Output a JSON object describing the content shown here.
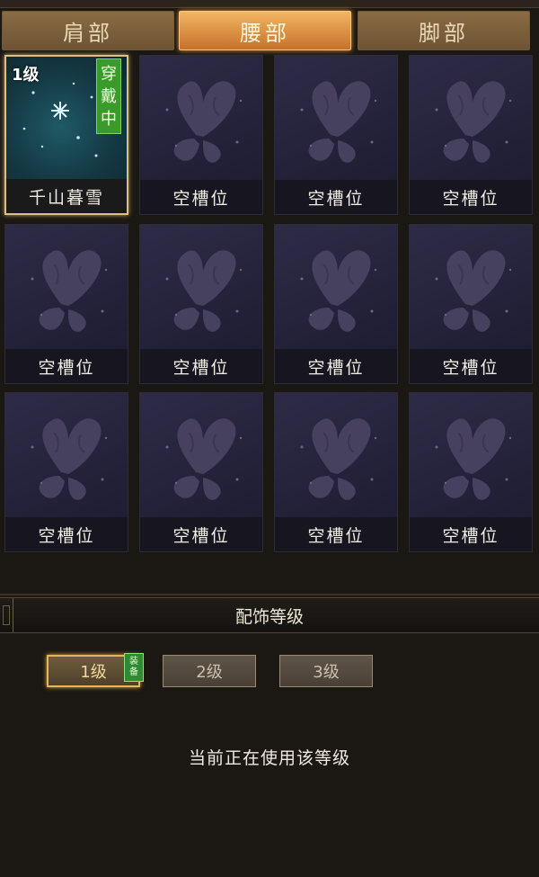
{
  "tabs": [
    {
      "label": "肩部",
      "active": false
    },
    {
      "label": "腰部",
      "active": true
    },
    {
      "label": "脚部",
      "active": false
    }
  ],
  "slots": [
    {
      "label": "千山暮雪",
      "level": "1级",
      "wearing": "穿戴中",
      "icon": "snowflake-icon"
    },
    {
      "label": "空槽位",
      "icon": "butterfly-icon"
    },
    {
      "label": "空槽位",
      "icon": "butterfly-icon"
    },
    {
      "label": "空槽位",
      "icon": "butterfly-icon"
    },
    {
      "label": "空槽位",
      "icon": "butterfly-icon"
    },
    {
      "label": "空槽位",
      "icon": "butterfly-icon"
    },
    {
      "label": "空槽位",
      "icon": "butterfly-icon"
    },
    {
      "label": "空槽位",
      "icon": "butterfly-icon"
    },
    {
      "label": "空槽位",
      "icon": "butterfly-icon"
    },
    {
      "label": "空槽位",
      "icon": "butterfly-icon"
    },
    {
      "label": "空槽位",
      "icon": "butterfly-icon"
    },
    {
      "label": "空槽位",
      "icon": "butterfly-icon"
    }
  ],
  "accessory_level": {
    "title": "配饰等级",
    "levels": [
      {
        "label": "1级",
        "current": true
      },
      {
        "label": "2级",
        "current": false
      },
      {
        "label": "3级",
        "current": false
      }
    ],
    "equipped_badge": "装备",
    "status": "当前正在使用该等级"
  },
  "colors": {
    "active_tab": "#e8923a",
    "wearing_badge": "#3a9a2a",
    "background": "#1b1712"
  }
}
